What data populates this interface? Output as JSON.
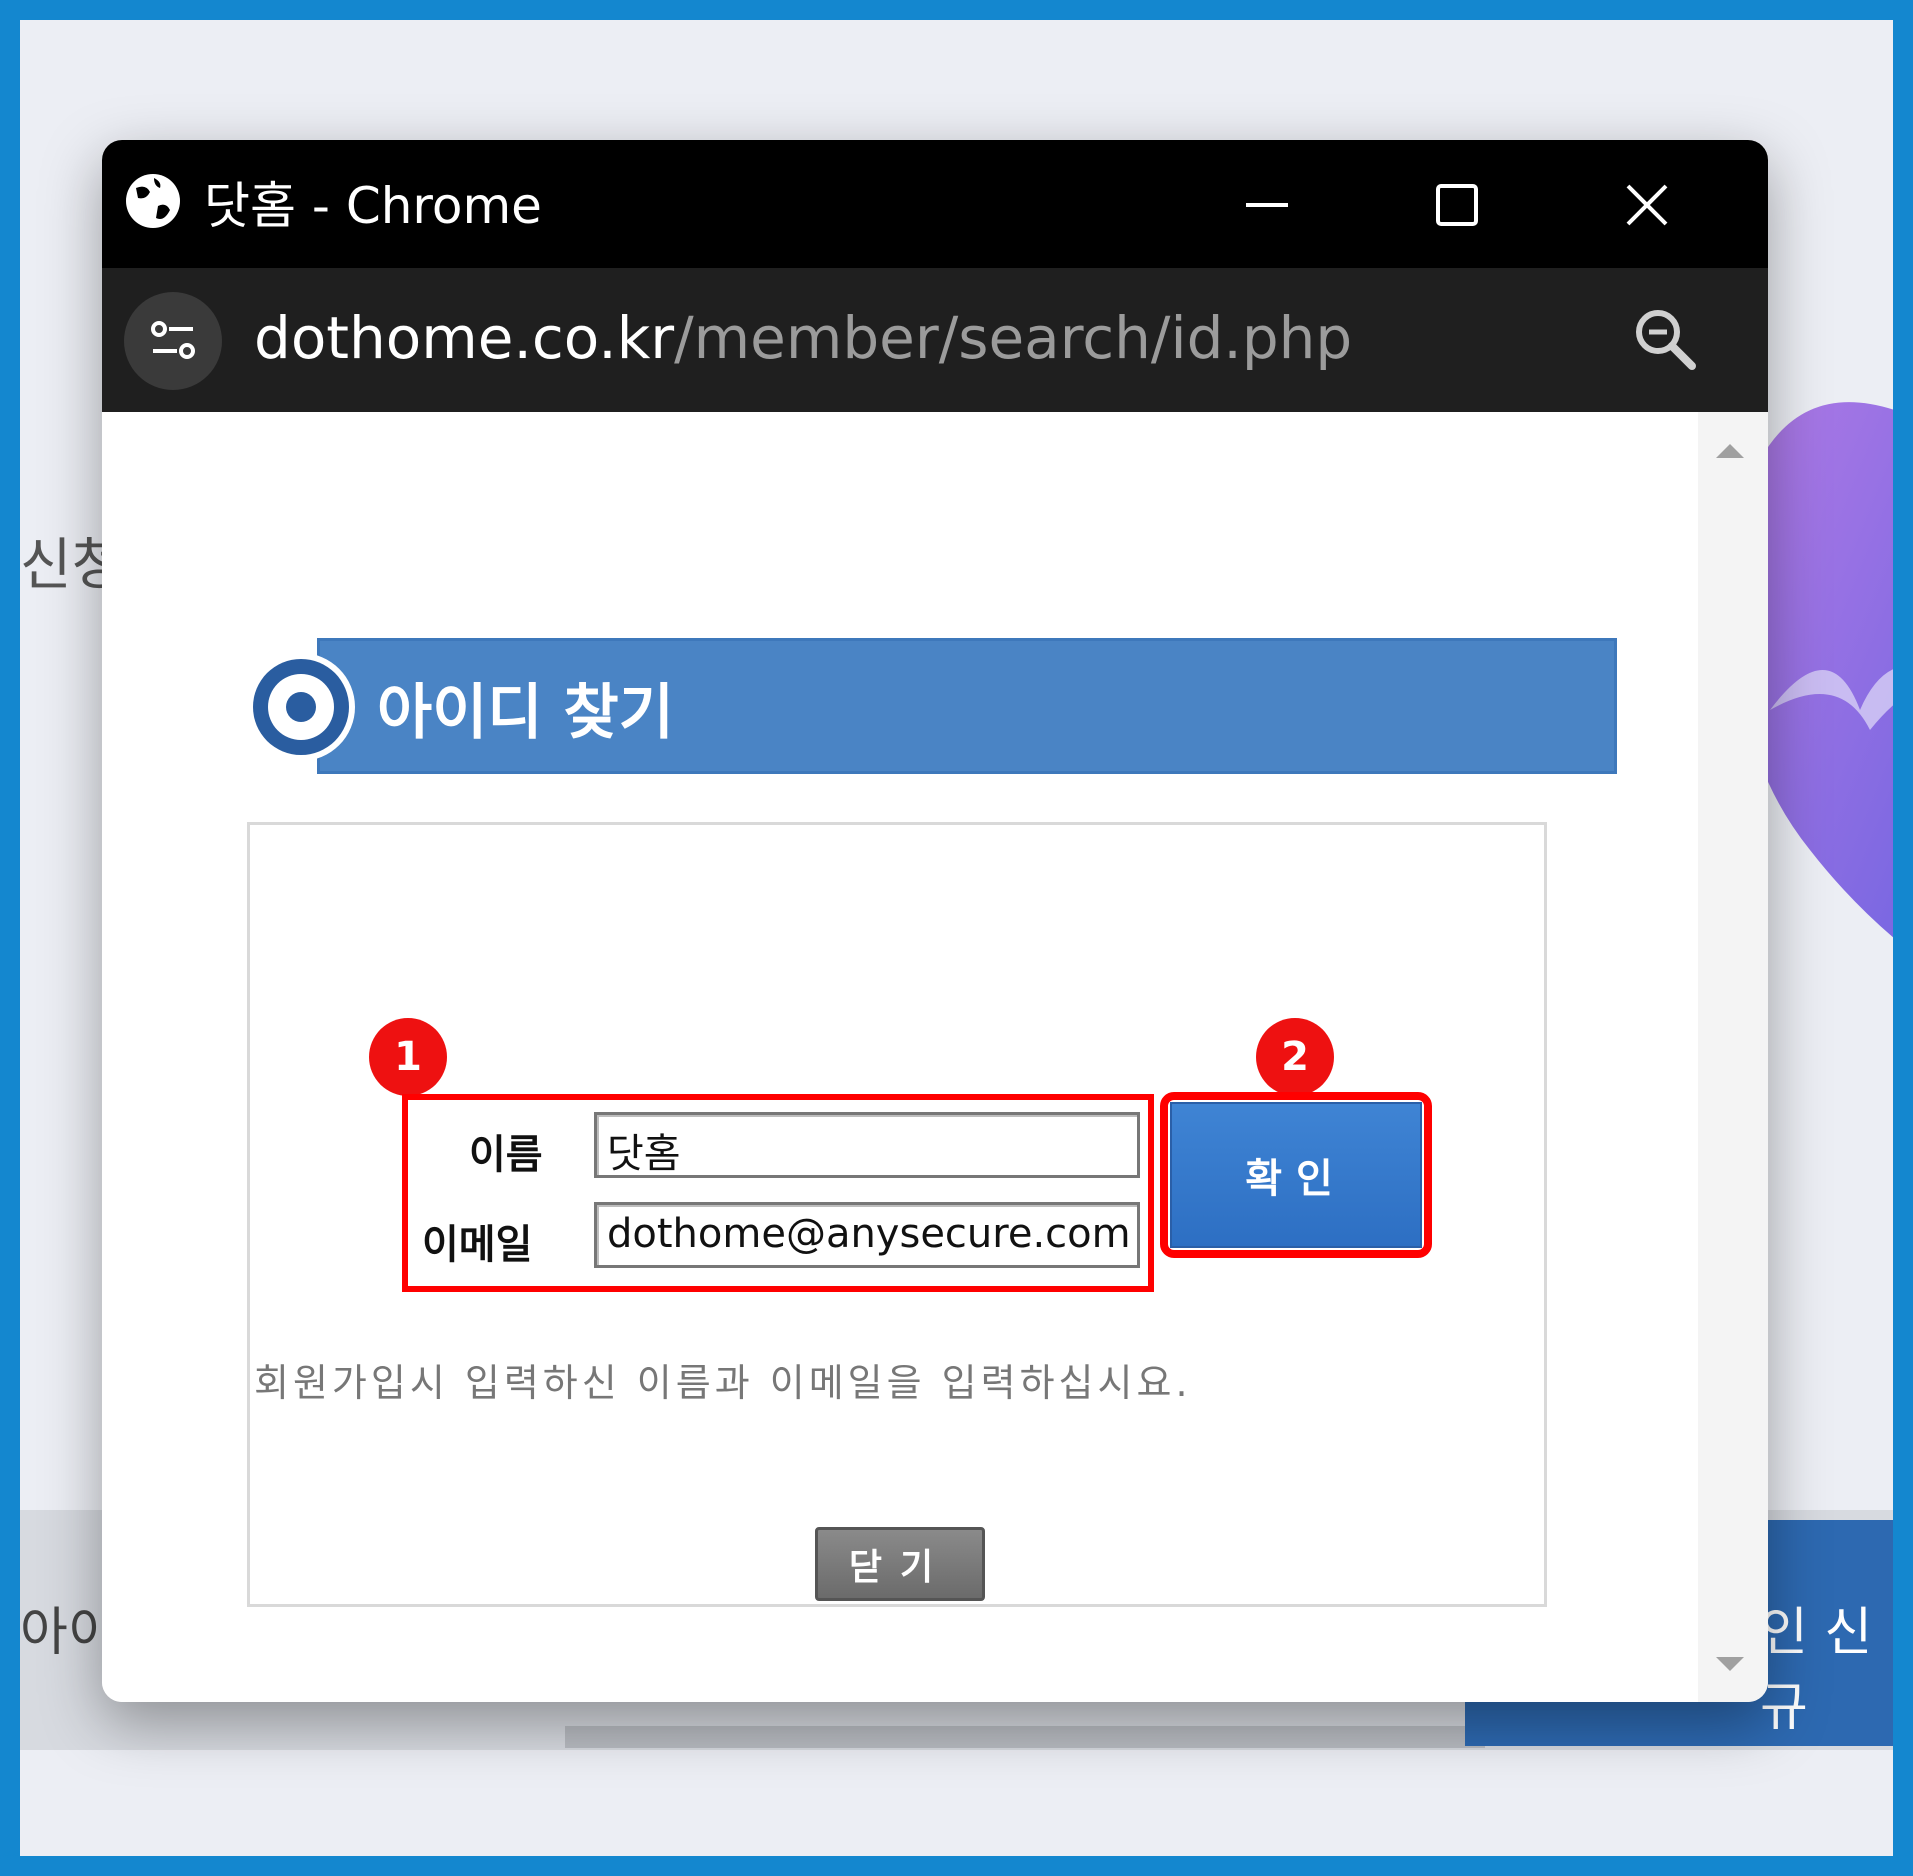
{
  "window": {
    "title": "닷홈 - Chrome",
    "url_host": "dothome.co.kr",
    "url_path": "/member/search/id.php",
    "icons": [
      "globe-icon",
      "minimize-icon",
      "maximize-icon",
      "close-icon",
      "site-info-icon",
      "zoom-icon"
    ]
  },
  "page": {
    "heading": "아이디 찾기",
    "heading_icon": "target-icon",
    "fields": {
      "name_label": "이름",
      "name_value": "닷홈",
      "email_label": "이메일",
      "email_value": "dothome@anysecure.com"
    },
    "confirm_label": "확인",
    "instruction": "회원가입시 입력하신 이름과 이메일을 입력하십시요.",
    "close_label": "닫기"
  },
  "annotations": {
    "badge_1": "1",
    "badge_2": "2",
    "highlight_color": "#ff0000"
  },
  "background": {
    "left_text_top": "신청",
    "left_text_bottom": "아이디",
    "right_text_bottom": "인 신규"
  },
  "colors": {
    "frame": "#1487cf",
    "heading_bar": "#4a84c5",
    "confirm_button": "#3579cc",
    "badge": "#ee1111"
  }
}
